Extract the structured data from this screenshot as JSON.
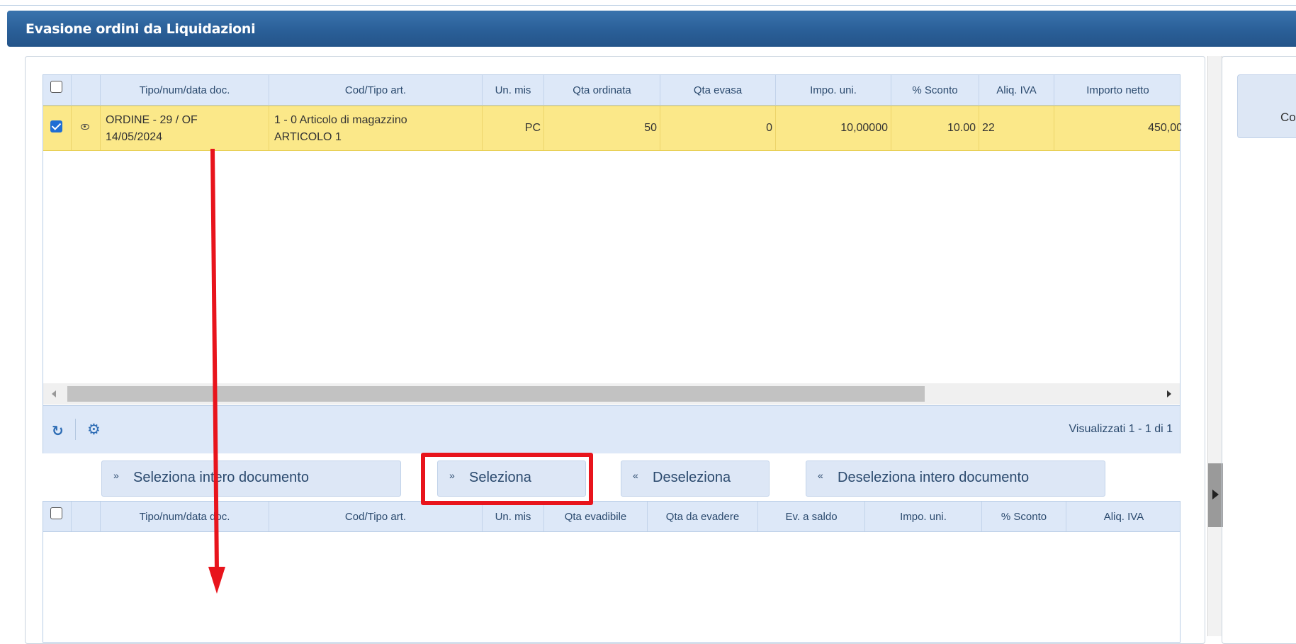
{
  "window": {
    "title": "Evasione ordini da Liquidazioni"
  },
  "top_grid": {
    "columns": [
      "Tipo/num/data doc.",
      "Cod/Tipo art.",
      "Un. mis",
      "Qta ordinata",
      "Qta evasa",
      "Impo. uni.",
      "% Sconto",
      "Aliq. IVA",
      "Importo netto"
    ],
    "rows": [
      {
        "selected": true,
        "doc_line1": "ORDINE - 29 / OF",
        "doc_line2": "14/05/2024",
        "art_line1": "1 - 0 Articolo di magazzino",
        "art_line2": "ARTICOLO 1",
        "um": "PC",
        "qta_ordinata": "50",
        "qta_evasa": "0",
        "impo_uni": "10,00000",
        "sconto": "10.00",
        "aliq_iva": "22",
        "importo_netto": "450,00"
      }
    ],
    "pager": "Visualizzati 1 - 1 di 1"
  },
  "buttons": {
    "select_all_doc": "Seleziona intero documento",
    "select": "Seleziona",
    "deselect": "Deseleziona",
    "deselect_all_doc": "Deseleziona intero documento"
  },
  "bottom_grid": {
    "columns": [
      "Tipo/num/data doc.",
      "Cod/Tipo art.",
      "Un. mis",
      "Qta evadibile",
      "Qta da evadere",
      "Ev. a saldo",
      "Impo. uni.",
      "% Sconto",
      "Aliq. IVA"
    ]
  },
  "right_panel": {
    "button_label": "Co"
  },
  "colors": {
    "selected_row": "#fbe889",
    "header": "#dde8f8",
    "titlebar": "#2a5f98",
    "annotation": "#e8141c"
  },
  "icons": [
    "eye-icon",
    "refresh-icon",
    "gear-icon",
    "chevron-double-down-icon",
    "chevron-double-up-icon"
  ]
}
